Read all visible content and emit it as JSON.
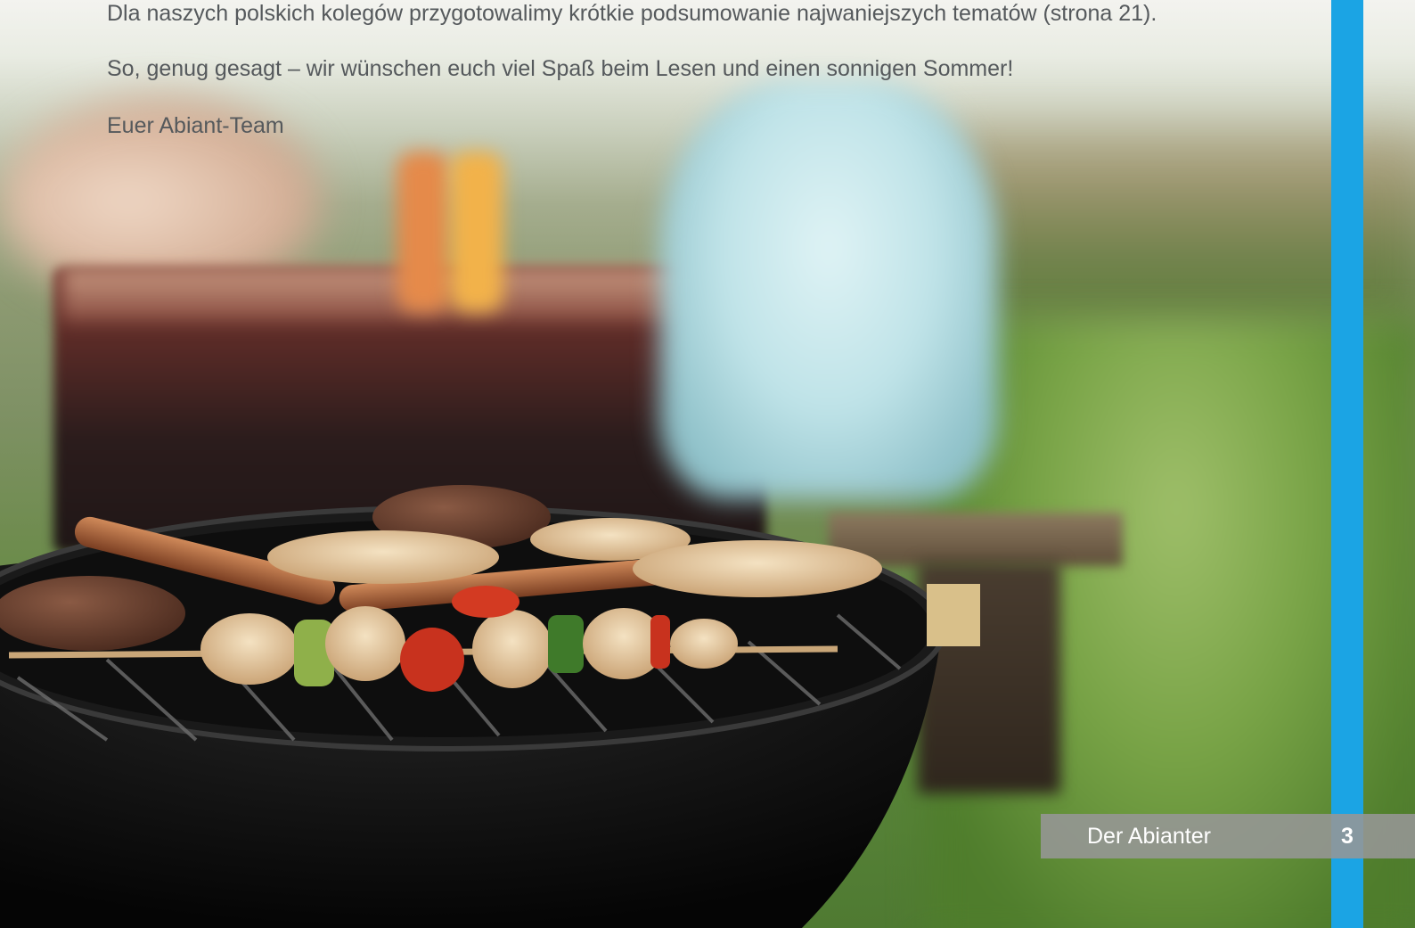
{
  "body_text": {
    "paragraph_1": "Dla naszych polskich kolegów przygotowalimy krótkie podsumowanie najwaniejszych tematów (strona 21).",
    "paragraph_2": "So, genug gesagt – wir wünschen euch viel Spaß beim Lesen und einen sonnigen Sommer!",
    "signature": "Euer Abiant-Team"
  },
  "footer": {
    "publication_title": "Der Abianter",
    "page_number": "3"
  },
  "colors": {
    "accent_stripe": "#1ba4e4",
    "text": "#55595c",
    "footer_bar": "#969696"
  }
}
